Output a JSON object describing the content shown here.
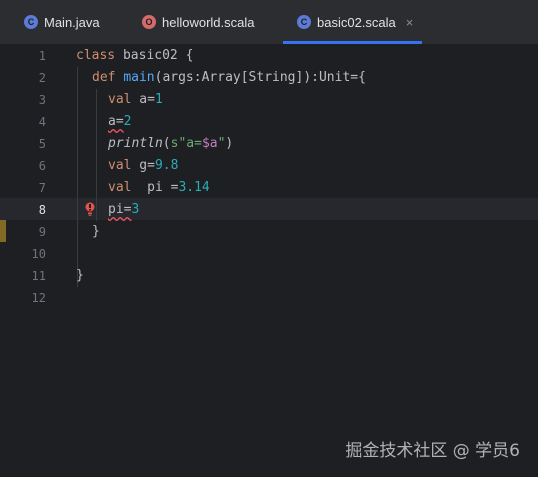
{
  "tabs": [
    {
      "label": "Main.java",
      "icon": "java-class-icon"
    },
    {
      "label": "helloworld.scala",
      "icon": "scala-object-icon"
    },
    {
      "label": "basic02.scala",
      "icon": "scala-class-icon",
      "active": true
    }
  ],
  "close_glyph": "×",
  "line_numbers": [
    "1",
    "2",
    "3",
    "4",
    "5",
    "6",
    "7",
    "8",
    "9",
    "10",
    "11",
    "12"
  ],
  "current_line": "8",
  "code": {
    "l1": {
      "kw": "class",
      "name": " basic02 {"
    },
    "l2": {
      "kw": "def",
      "fn": "main",
      "rest": "(args:Array[String]):Unit={"
    },
    "l3": {
      "kw": "val",
      "name": " a=",
      "num": "1"
    },
    "l4": {
      "name": "a=",
      "num": "2"
    },
    "l5": {
      "fn": "println",
      "open": "(",
      "str_prefix": "s\"a=",
      "interp": "$a",
      "str_suffix": "\"",
      "close": ")"
    },
    "l6": {
      "kw": "val",
      "name": " g=",
      "num": "9.8"
    },
    "l7": {
      "kw": "val",
      "name": "  pi =",
      "num": "3.14"
    },
    "l8": {
      "name": "pi=",
      "num": "3"
    },
    "l9": "}",
    "l11": "}"
  },
  "watermark": "掘金技术社区 @ 学员6"
}
